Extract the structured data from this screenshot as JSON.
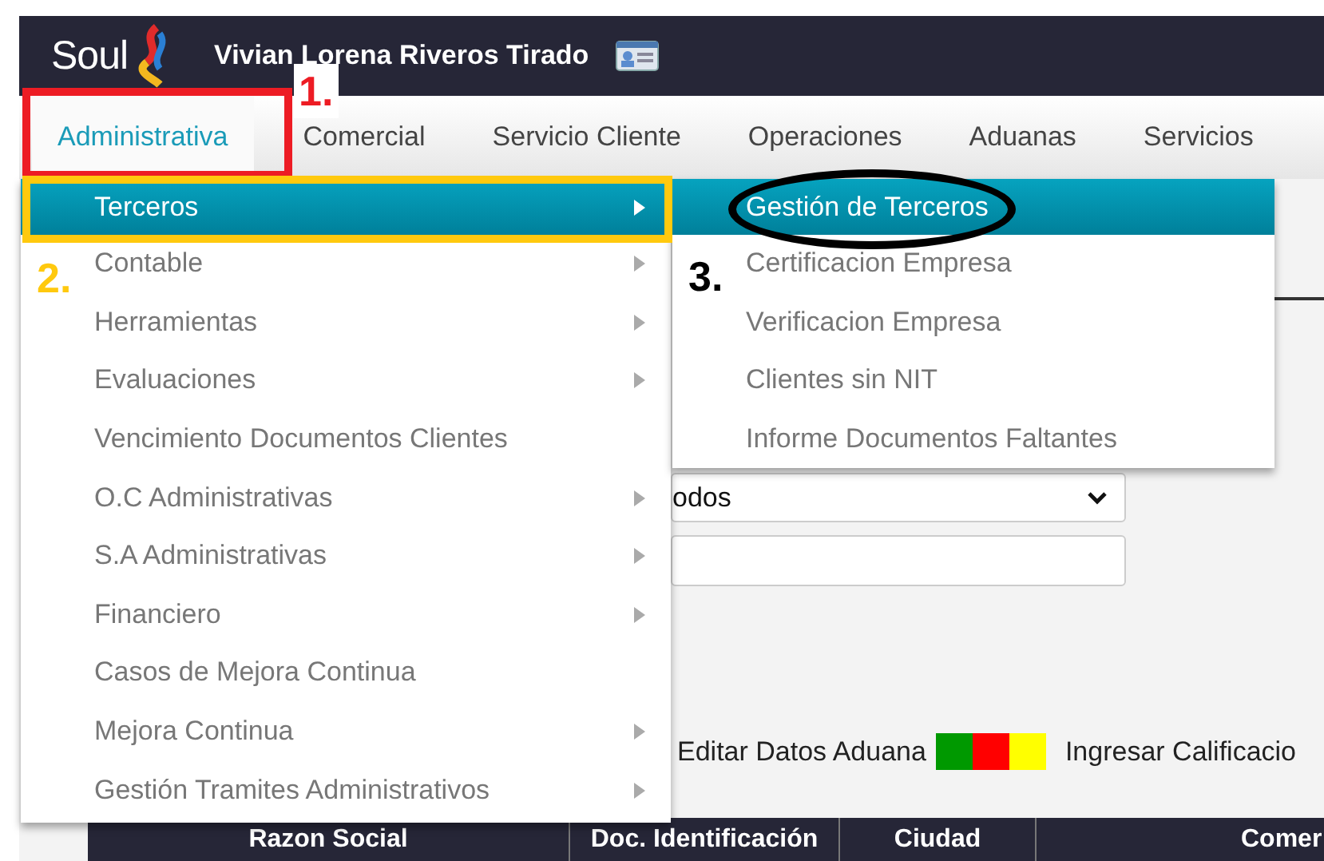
{
  "header": {
    "logo": "Soul",
    "user_name": "Vivian Lorena Riveros Tirado"
  },
  "tabs": [
    {
      "label": "Administrativa",
      "selected": true
    },
    {
      "label": "Comercial",
      "selected": false
    },
    {
      "label": "Servicio Cliente",
      "selected": false
    },
    {
      "label": "Operaciones",
      "selected": false
    },
    {
      "label": "Aduanas",
      "selected": false
    },
    {
      "label": "Servicios",
      "selected": false
    }
  ],
  "menu": {
    "items": [
      {
        "label": "Terceros",
        "selected": true,
        "has_submenu": true
      },
      {
        "label": "Contable",
        "selected": false,
        "has_submenu": true
      },
      {
        "label": "Herramientas",
        "selected": false,
        "has_submenu": true
      },
      {
        "label": "Evaluaciones",
        "selected": false,
        "has_submenu": true
      },
      {
        "label": "Vencimiento Documentos Clientes",
        "selected": false,
        "has_submenu": false
      },
      {
        "label": "O.C Administrativas",
        "selected": false,
        "has_submenu": true
      },
      {
        "label": "S.A Administrativas",
        "selected": false,
        "has_submenu": true
      },
      {
        "label": "Financiero",
        "selected": false,
        "has_submenu": true
      },
      {
        "label": "Casos de Mejora Continua",
        "selected": false,
        "has_submenu": false
      },
      {
        "label": "Mejora Continua",
        "selected": false,
        "has_submenu": true
      },
      {
        "label": "Gestión Tramites Administrativos",
        "selected": false,
        "has_submenu": true
      }
    ]
  },
  "submenu": {
    "items": [
      {
        "label": "Gestión de Terceros",
        "selected": true
      },
      {
        "label": "Certificacion Empresa",
        "selected": false
      },
      {
        "label": "Verificacion Empresa",
        "selected": false
      },
      {
        "label": "Clientes sin NIT",
        "selected": false
      },
      {
        "label": "Informe Documentos Faltantes",
        "selected": false
      }
    ]
  },
  "form": {
    "select_value": "odos",
    "actions": [
      {
        "label": "Editar Datos Aduana"
      },
      {
        "label": "Ingresar Calificacio"
      }
    ],
    "legend": [
      {
        "color": "#009900"
      },
      {
        "color": "#ff0000"
      },
      {
        "color": "#ffff00"
      }
    ]
  },
  "table": {
    "columns": [
      "Razon Social",
      "Doc. Identificación",
      "Ciudad",
      "Comer"
    ]
  },
  "annotations": [
    {
      "kind": "box",
      "label": "1.",
      "color": "#ed1c24"
    },
    {
      "kind": "box",
      "label": "2.",
      "color": "#ffc90e"
    },
    {
      "kind": "ellipse",
      "label": "3.",
      "color": "#000000"
    }
  ]
}
